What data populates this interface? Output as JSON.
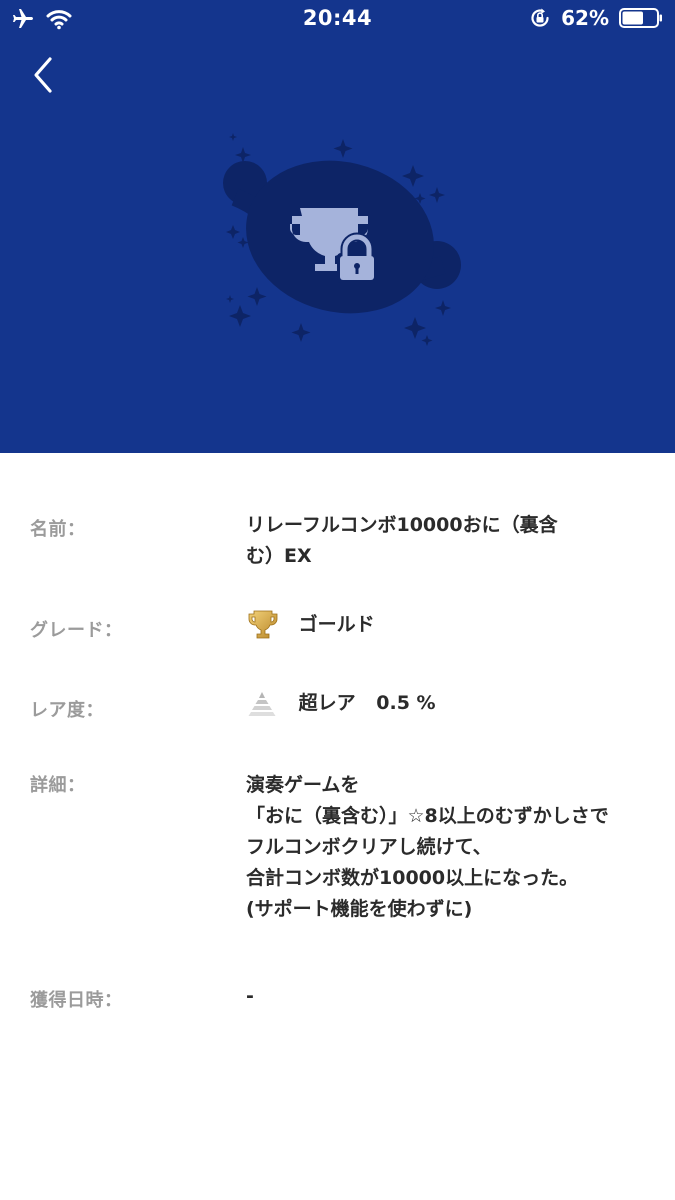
{
  "status_bar": {
    "time": "20:44",
    "battery_percent": "62%",
    "battery_level": 0.62,
    "icons": [
      "airplane-icon",
      "wifi-icon",
      "orientation-lock-icon",
      "battery-icon"
    ]
  },
  "hero": {
    "background_color": "#14358d",
    "badge_icon": "trophy-lock-icon",
    "back_icon": "chevron-left-icon"
  },
  "details": {
    "name": {
      "label": "名前：",
      "value_line1": "リレーフルコンボ10000おに（裏含",
      "value_line2": "む）EX"
    },
    "grade": {
      "label": "グレード：",
      "icon": "gold-trophy-icon",
      "value": "ゴールド"
    },
    "rarity": {
      "label": "レア度：",
      "icon": "rarity-pyramid-icon",
      "value": "超レア",
      "percent": "0.5 %"
    },
    "description": {
      "label": "詳細：",
      "lines": [
        "演奏ゲームを",
        "「おに（裏含む）」☆8以上のむずかしさで",
        "フルコンボクリアし続けて、",
        "合計コンボ数が10000以上になった。",
        "(サポート機能を使わずに)"
      ]
    },
    "acquired": {
      "label": "獲得日時：",
      "value": "-"
    }
  }
}
